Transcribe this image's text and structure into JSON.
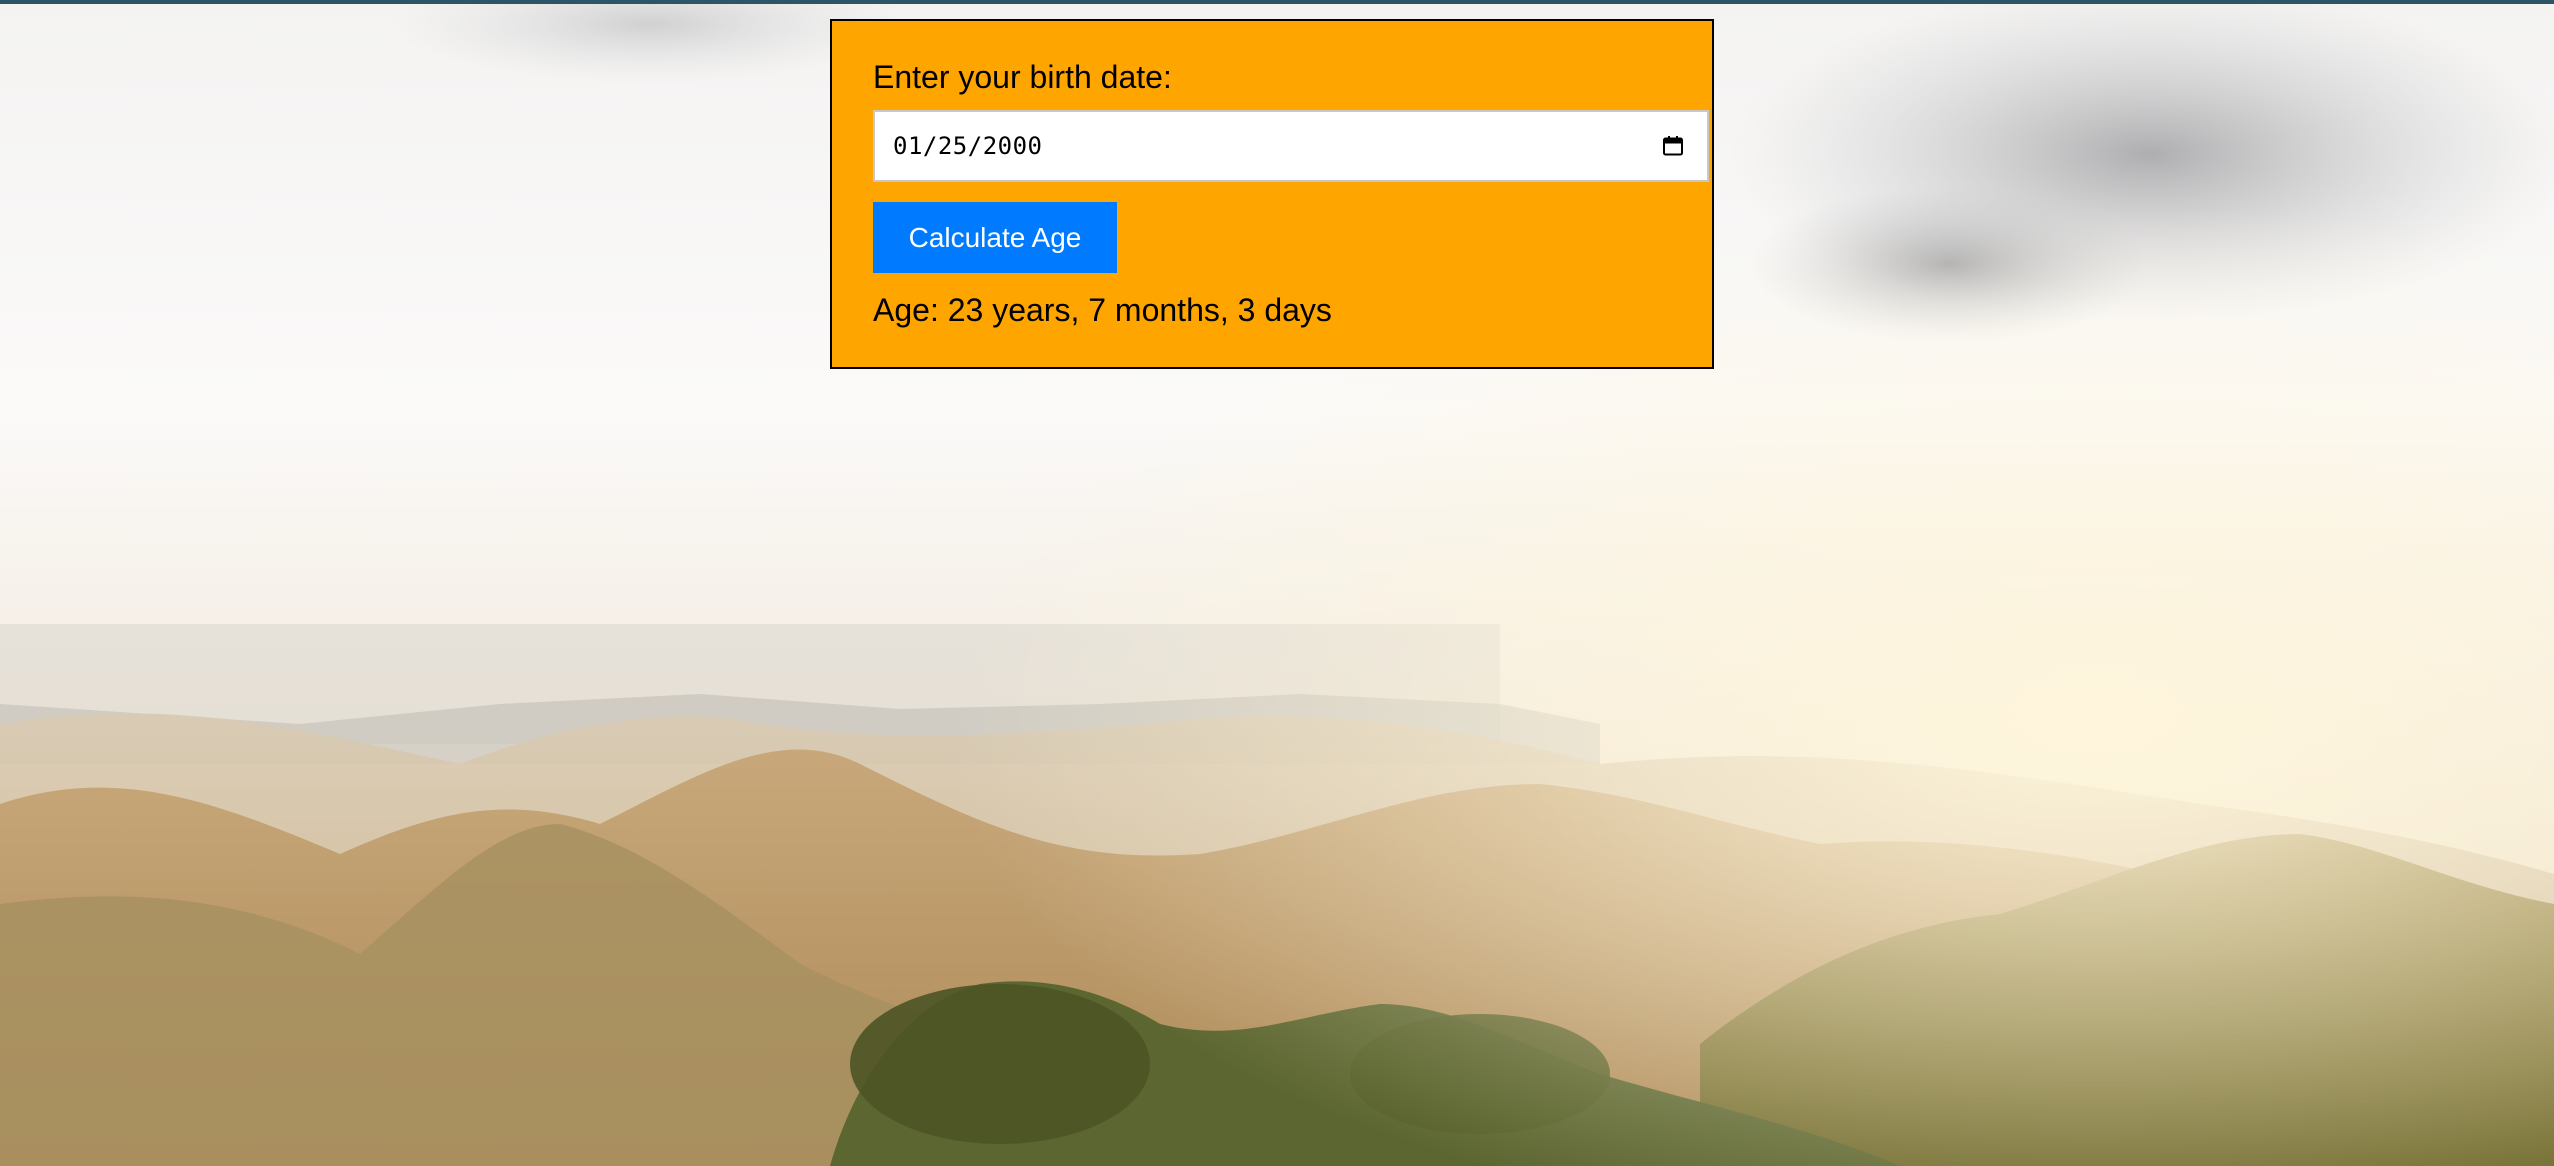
{
  "form": {
    "label": "Enter your birth date:",
    "date_value": "01/25/2000",
    "button_label": "Calculate Age",
    "result_text": "Age: 23 years, 7 months, 3 days"
  },
  "icons": {
    "date_picker": "calendar-icon"
  },
  "colors": {
    "card_background": "#ffa500",
    "button_background": "#007bff",
    "button_text": "#ffffff"
  }
}
